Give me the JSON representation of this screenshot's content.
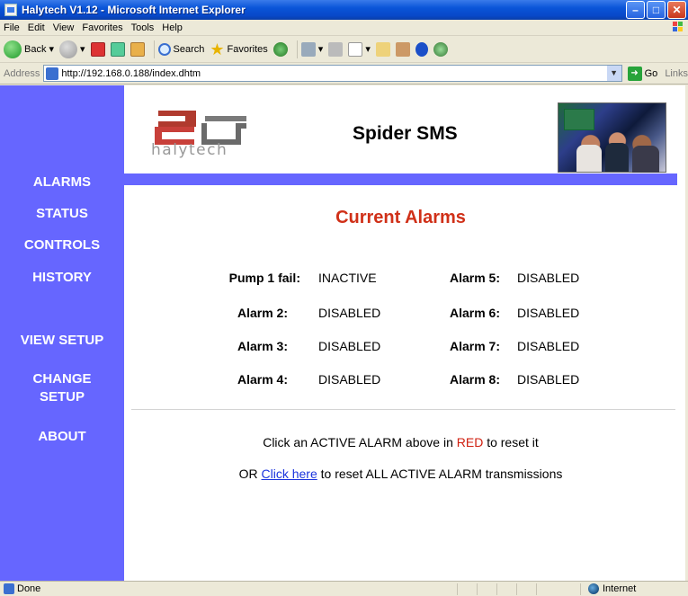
{
  "window": {
    "title": "Halytech V1.12 - Microsoft Internet Explorer"
  },
  "menu": [
    "File",
    "Edit",
    "View",
    "Favorites",
    "Tools",
    "Help"
  ],
  "toolbar": {
    "back_label": "Back",
    "search_label": "Search",
    "favorites_label": "Favorites"
  },
  "address": {
    "label": "Address",
    "url": "http://192.168.0.188/index.dhtm",
    "go_label": "Go",
    "links_label": "Links"
  },
  "sidebar": {
    "items": [
      {
        "label": "ALARMS"
      },
      {
        "label": "STATUS"
      },
      {
        "label": "CONTROLS"
      },
      {
        "label": "HISTORY"
      },
      {
        "label": "VIEW SETUP"
      },
      {
        "label": "CHANGE SETUP"
      },
      {
        "label": "ABOUT"
      }
    ]
  },
  "header": {
    "logo_text": "halytech",
    "app_title": "Spider SMS"
  },
  "page": {
    "heading": "Current Alarms",
    "alarms": [
      {
        "label": "Pump 1 fail:",
        "status": "INACTIVE"
      },
      {
        "label": "Alarm 2:",
        "status": "DISABLED"
      },
      {
        "label": "Alarm 3:",
        "status": "DISABLED"
      },
      {
        "label": "Alarm 4:",
        "status": "DISABLED"
      },
      {
        "label": "Alarm 5:",
        "status": "DISABLED"
      },
      {
        "label": "Alarm 6:",
        "status": "DISABLED"
      },
      {
        "label": "Alarm 7:",
        "status": "DISABLED"
      },
      {
        "label": "Alarm 8:",
        "status": "DISABLED"
      }
    ],
    "reset_msg_pre": "Click an ACTIVE ALARM above in ",
    "reset_msg_red": "RED",
    "reset_msg_post": " to reset it",
    "reset_all_pre": "OR ",
    "reset_all_link": "Click here",
    "reset_all_post": " to reset ALL ACTIVE ALARM transmissions"
  },
  "status": {
    "text": "Done",
    "zone": "Internet"
  },
  "colors": {
    "sidebar": "#6666ff",
    "heading": "#d03018",
    "link": "#1a33dd"
  }
}
